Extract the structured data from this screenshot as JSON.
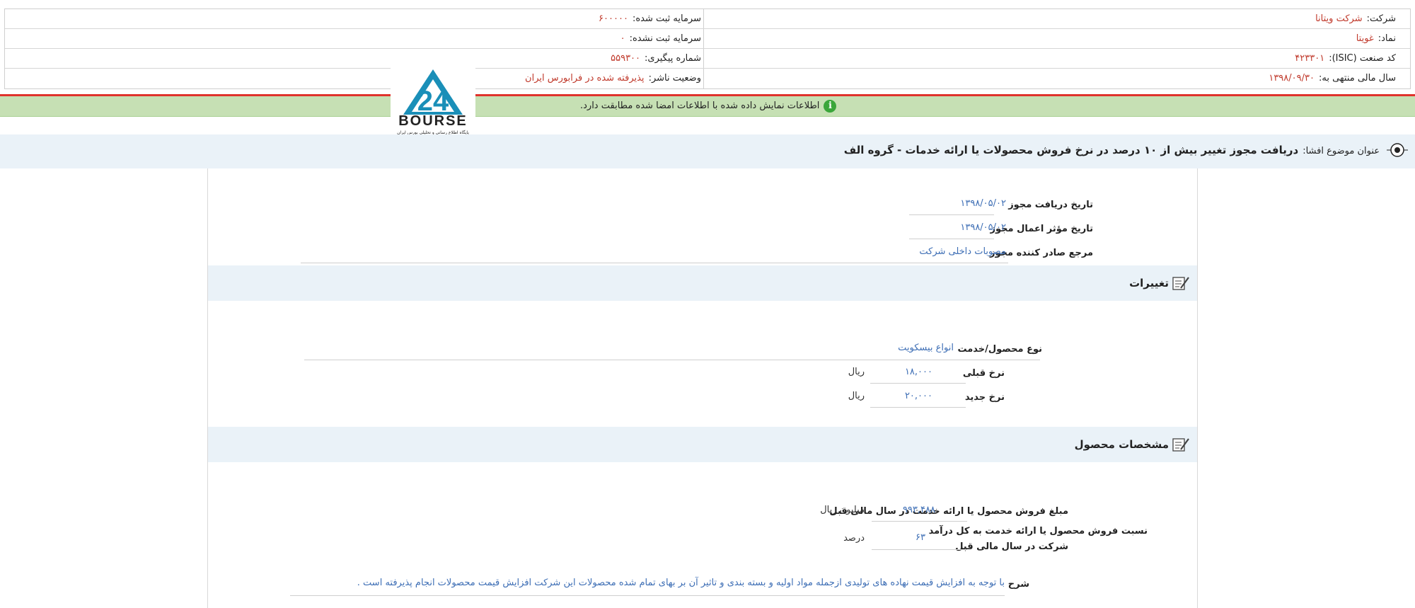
{
  "header_info": {
    "right": [
      {
        "label": "شرکت:",
        "value": "شرکت ویتانا"
      },
      {
        "label": "نماد:",
        "value": "غویتا"
      },
      {
        "label": "کد صنعت (ISIC):",
        "value": "۴۲۳۳۰۱"
      },
      {
        "label": "سال مالی منتهی به:",
        "value": "۱۳۹۸/۰۹/۳۰"
      }
    ],
    "left": [
      {
        "label": "سرمایه ثبت شده:",
        "value": "۶۰۰۰۰۰"
      },
      {
        "label": "سرمایه ثبت نشده:",
        "value": "۰"
      },
      {
        "label": "شماره پیگیری:",
        "value": "۵۵۹۳۰۰"
      },
      {
        "label": "وضعیت ناشر:",
        "value": "پذیرفته شده در فرابورس ایران"
      }
    ]
  },
  "notice": {
    "text": "اطلاعات نمایش داده شده با اطلاعات امضا شده مطابقت دارد.",
    "icon": "info-icon",
    "color": "#c6e0b4"
  },
  "logo": {
    "text": "BOURSE",
    "caption": "پایگاه اطلاع رسانی و تحلیلی بورس ایران",
    "color": "#1a8fb8"
  },
  "subject": {
    "label": "عنوان موضوع افشا:",
    "title": "دریافت مجوز تغییر بیش از ۱۰ درصد در نرخ فروش محصولات یا ارائه خدمات - گروه الف"
  },
  "license": {
    "receive_date_label": "تاریخ دریافت مجوز",
    "receive_date": "۱۳۹۸/۰۵/۰۲",
    "effective_date_label": "تاریخ مؤثر اعمال مجوز",
    "effective_date": "۱۳۹۸/۰۵/۰۲",
    "issuer_label": "مرجع صادر کننده مجوز",
    "issuer": "مصوبات داخلی شرکت"
  },
  "changes": {
    "section_title": "تغییرات",
    "product_label": "نوع محصول/خدمت",
    "product": "انواع بیسکویت",
    "old_rate_label": "نرخ قبلی",
    "old_rate": "۱۸,۰۰۰",
    "new_rate_label": "نرخ جدید",
    "new_rate": "۲۰,۰۰۰",
    "currency": "ریال"
  },
  "specs": {
    "section_title": "مشخصات محصول",
    "sales_label": "مبلغ فروش محصول یا ارائه خدمت در سال مالی قبل",
    "sales_value": "۹۹۳,۴۸۸",
    "sales_unit": "میلیون ریال",
    "ratio_label_1": "نسبت فروش محصول یا ارائه خدمت به کل درآمد",
    "ratio_label_2": "شرکت در سال مالی قبل",
    "ratio_value": "۶۳",
    "ratio_unit": "درصد",
    "desc_label": "شرح",
    "desc": "با توجه به افزایش قیمت نهاده های تولیدی ازجمله مواد اولیه و بسته بندی و تاثیر آن بر بهای تمام شده محصولات این شرکت افزایش قیمت محصولات انجام پذیرفته است ."
  }
}
